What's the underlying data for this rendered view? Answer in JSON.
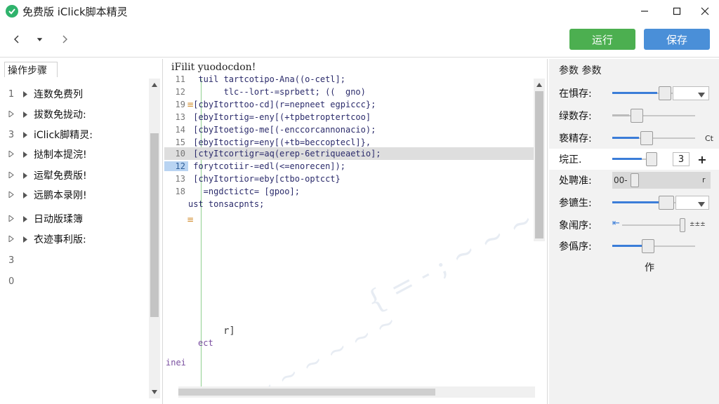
{
  "window": {
    "title": "免费版 iClick脚本精灵",
    "minimize": "minimize-icon",
    "maximize": "maximize-icon",
    "close": "close-icon"
  },
  "toolbar": {
    "run_label": "运行",
    "save_label": "保存",
    "run_color": "#4caf50",
    "save_color": "#4a8fd8"
  },
  "steps_panel": {
    "title": "操作步骤",
    "items": [
      {
        "num": "1",
        "label": "连数免费列"
      },
      {
        "num": "",
        "label": "拔数免拢动:"
      },
      {
        "num": "3",
        "label": "iClick脚精灵:"
      },
      {
        "num": "",
        "label": "挞制本提浣!"
      },
      {
        "num": "",
        "label": "运犚免费版!"
      },
      {
        "num": "",
        "label": "远鹏本录刚!"
      },
      {
        "num": "",
        "label": "日动版瑈簿"
      },
      {
        "num": "",
        "label": "衣迹事利版:"
      }
    ],
    "extra_numbers": [
      "3",
      "0"
    ]
  },
  "editor": {
    "title": "iFilit yuodocdon!",
    "lines": [
      {
        "ln": "11",
        "text": "  tuil tartcotipo-Ana((o-cetl];"
      },
      {
        "ln": "12",
        "text": "       tlc--lort-=sprbett; ((  gno)"
      },
      {
        "ln": "19",
        "text": " [cbyItorttoo-cd](r=nepneet egpiccc};"
      },
      {
        "ln": "13",
        "text": " [ebyItortig=-eny[(+tpbetroptertcoo]"
      },
      {
        "ln": "14",
        "text": " [cbyItoetigo-me[(-enccorcannonacio);"
      },
      {
        "ln": "15",
        "text": " [ebyItoctigr=eny[(+tb=beccoptecl]},"
      },
      {
        "ln": "10",
        "text": " [ctyItcortigr=aq(erep-6etriqueaetio];"
      },
      {
        "ln": "12",
        "text": " forytcotiir-=edl(<=enorecen]);"
      },
      {
        "ln": "13",
        "text": " [chyItortior=eby[ctbo-optcct}"
      },
      {
        "ln": "18",
        "text": "   =ngdctictc= [gpoo];"
      },
      {
        "ln": "",
        "text": "ust tonsacpnts;"
      }
    ],
    "bottom_text_1": "ect",
    "bottom_text_2": "inei",
    "bottom_text_3": "r]"
  },
  "params_panel": {
    "title": "参数 参数",
    "rows": [
      {
        "label": "在惧存:",
        "fill": 0.48,
        "type": "dropdown"
      },
      {
        "label": "绿数存:",
        "fill": 0.2,
        "type": "slider"
      },
      {
        "label": "亵精存:",
        "fill": 0.35,
        "type": "slider",
        "suffix": "Ct"
      },
      {
        "label": "垸正.",
        "fill": 0.4,
        "type": "stepper",
        "value": "3"
      },
      {
        "label": "处聘准:",
        "fill": 0.15,
        "type": "boxed",
        "prefix": "00-",
        "suffix": "r"
      },
      {
        "label": "参镳生:",
        "fill": 0.55,
        "type": "dropdown"
      },
      {
        "label": "象闱序:",
        "fill": 0.9,
        "type": "slider2",
        "suffix": "±±±"
      },
      {
        "label": "参僞序:",
        "fill": 0.4,
        "type": "slider"
      }
    ],
    "footer_text": "作"
  }
}
